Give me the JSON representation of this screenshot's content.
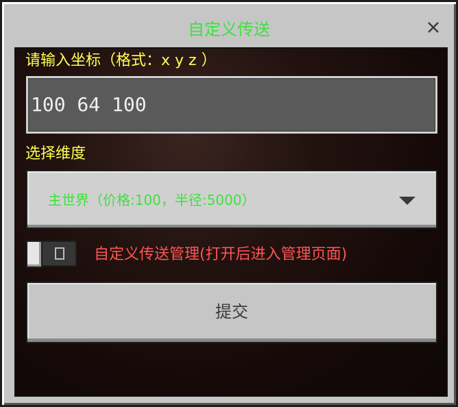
{
  "dialog": {
    "title": "自定义传送",
    "title_color": "#3ee13e",
    "close_icon": "close-icon"
  },
  "coordinates": {
    "label": "请输入坐标（格式：x y z ）",
    "value": "100 64 100"
  },
  "dimension": {
    "label": "选择维度",
    "selected": "主世界（价格:100，半径:5000）",
    "caret_icon": "chevron-down-icon"
  },
  "manage_toggle": {
    "label": "自定义传送管理(打开后进入管理页面)",
    "state": "off"
  },
  "submit": {
    "label": "提交"
  }
}
